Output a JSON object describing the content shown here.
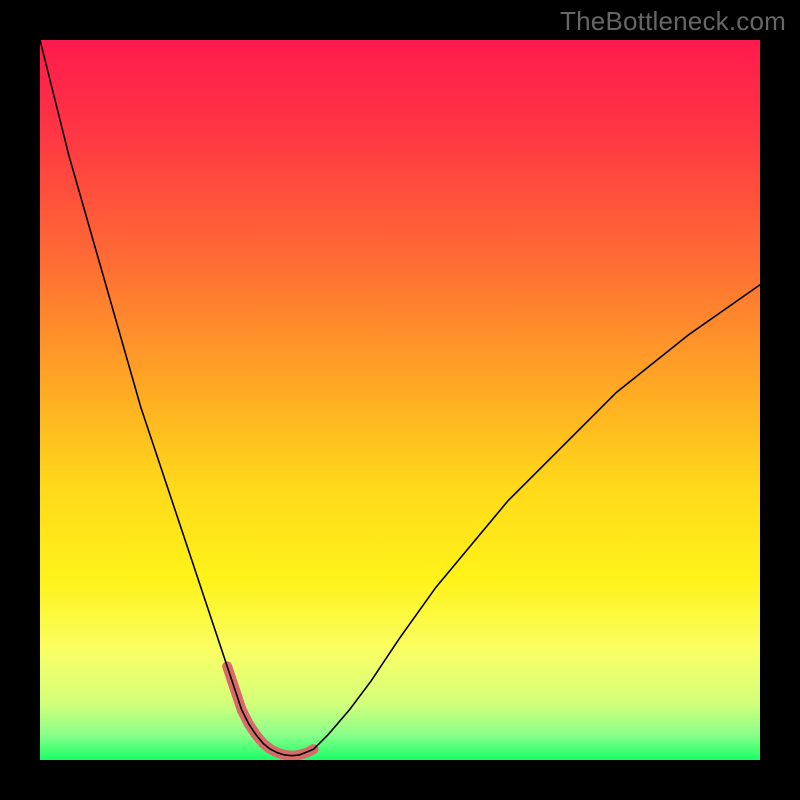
{
  "watermark": "TheBottleneck.com",
  "chart_data": {
    "type": "line",
    "title": "",
    "xlabel": "",
    "ylabel": "",
    "xlim": [
      0,
      100
    ],
    "ylim": [
      0,
      100
    ],
    "background_gradient": {
      "stops": [
        {
          "t": 0.0,
          "color": "#ff1a4d"
        },
        {
          "t": 0.12,
          "color": "#ff3444"
        },
        {
          "t": 0.3,
          "color": "#ff6a35"
        },
        {
          "t": 0.48,
          "color": "#ffa824"
        },
        {
          "t": 0.62,
          "color": "#ffd91a"
        },
        {
          "t": 0.75,
          "color": "#fff31a"
        },
        {
          "t": 0.85,
          "color": "#f9ff66"
        },
        {
          "t": 0.92,
          "color": "#d4ff7a"
        },
        {
          "t": 0.965,
          "color": "#8aff8a"
        },
        {
          "t": 1.0,
          "color": "#1aff66"
        }
      ]
    },
    "series": [
      {
        "name": "bottleneck-curve",
        "color": "#000000",
        "width": 1.6,
        "x": [
          0,
          2,
          4,
          6,
          8,
          10,
          12,
          14,
          16,
          18,
          20,
          22,
          24,
          25,
          26,
          27,
          28,
          29,
          30,
          31,
          32,
          33,
          34,
          35,
          36,
          38,
          40,
          43,
          46,
          50,
          55,
          60,
          65,
          70,
          75,
          80,
          85,
          90,
          95,
          100
        ],
        "y": [
          100,
          92,
          84,
          77,
          70,
          63,
          56,
          49,
          43,
          37,
          31,
          25,
          19,
          16,
          13,
          10,
          7,
          5,
          3.5,
          2.3,
          1.5,
          1.0,
          0.7,
          0.6,
          0.7,
          1.5,
          3.5,
          7,
          11,
          17,
          24,
          30,
          36,
          41,
          46,
          51,
          55,
          59,
          62.5,
          66
        ]
      }
    ],
    "highlight": {
      "name": "minimum-band",
      "color": "#d86a6a",
      "width": 10,
      "cap": "round",
      "x": [
        26,
        27,
        28,
        29,
        30,
        31,
        32,
        33,
        34,
        35,
        36,
        37,
        38
      ],
      "y": [
        13,
        10,
        7,
        5,
        3.5,
        2.3,
        1.5,
        1.0,
        0.7,
        0.6,
        0.7,
        1.0,
        1.5
      ]
    }
  }
}
